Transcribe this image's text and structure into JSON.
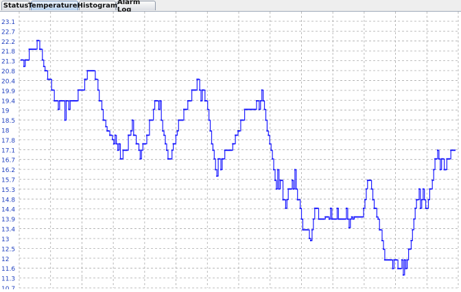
{
  "tabs": [
    {
      "label": "Status",
      "active": false
    },
    {
      "label": "Temperatures",
      "active": true
    },
    {
      "label": "Histogram",
      "active": false
    },
    {
      "label": "Alarm Log",
      "active": false
    }
  ],
  "colors": {
    "series": "#1a1aff",
    "grid": "#a8a8a8",
    "axis_text": "#1f3fbf"
  },
  "chart_data": {
    "type": "line",
    "grid": true,
    "ylim": [
      10.7,
      23.3
    ],
    "yticks": [
      "23.1",
      "22.7",
      "22.2",
      "21.8",
      "21.3",
      "20.8",
      "20.4",
      "19.9",
      "19.4",
      "19",
      "18.5",
      "18",
      "17.8",
      "17.1",
      "16.7",
      "16.2",
      "15.7",
      "15.3",
      "14.8",
      "14.4",
      "13.9",
      "13.4",
      "13",
      "12.5",
      "12",
      "11.6",
      "11.3",
      "10.7"
    ],
    "series": [
      {
        "values": [
          21.3,
          21.3,
          21.0,
          21.3,
          21.3,
          21.3,
          21.8,
          21.8,
          21.8,
          21.8,
          21.8,
          21.8,
          22.2,
          22.2,
          21.8,
          21.8,
          21.3,
          21.0,
          20.8,
          20.8,
          20.4,
          20.4,
          20.4,
          19.9,
          19.9,
          19.4,
          19.4,
          19.4,
          19.0,
          19.4,
          19.4,
          19.4,
          19.4,
          18.5,
          19.4,
          19.4,
          19.0,
          19.4,
          19.4,
          19.4,
          19.4,
          19.4,
          19.4,
          19.9,
          19.9,
          19.9,
          19.9,
          19.9,
          20.4,
          20.4,
          20.8,
          20.8,
          20.8,
          20.8,
          20.8,
          20.8,
          20.4,
          20.4,
          19.9,
          19.4,
          19.4,
          19.0,
          18.5,
          18.5,
          18.2,
          18.0,
          18.0,
          17.8,
          17.8,
          17.6,
          17.4,
          17.8,
          17.4,
          17.1,
          17.4,
          16.7,
          16.7,
          17.1,
          17.1,
          17.1,
          17.1,
          17.8,
          17.8,
          18.0,
          18.5,
          17.8,
          17.8,
          17.4,
          17.4,
          17.1,
          16.7,
          17.1,
          17.4,
          17.4,
          17.4,
          17.8,
          17.8,
          18.5,
          18.5,
          18.5,
          19.0,
          19.4,
          19.4,
          19.4,
          19.0,
          19.4,
          18.5,
          18.0,
          17.8,
          17.4,
          17.1,
          16.7,
          16.7,
          16.7,
          17.1,
          17.4,
          17.4,
          17.8,
          18.0,
          18.5,
          18.5,
          18.5,
          18.5,
          19.0,
          19.0,
          19.0,
          19.4,
          19.4,
          19.4,
          19.9,
          19.9,
          19.9,
          19.9,
          20.4,
          20.4,
          19.9,
          19.4,
          19.9,
          19.9,
          19.4,
          19.4,
          19.0,
          18.5,
          18.0,
          17.4,
          17.1,
          16.7,
          16.2,
          15.9,
          16.7,
          16.7,
          16.2,
          16.7,
          16.7,
          17.1,
          17.1,
          17.1,
          17.1,
          17.1,
          17.1,
          17.4,
          17.4,
          17.8,
          17.8,
          18.0,
          18.0,
          18.5,
          18.5,
          18.5,
          19.0,
          19.0,
          19.0,
          19.0,
          19.0,
          19.0,
          19.0,
          19.0,
          19.0,
          19.4,
          19.4,
          19.0,
          19.4,
          19.9,
          19.4,
          19.0,
          18.5,
          18.0,
          17.8,
          17.4,
          17.1,
          16.7,
          16.2,
          15.7,
          15.3,
          16.2,
          15.3,
          15.7,
          15.7,
          14.8,
          14.8,
          14.4,
          14.8,
          15.3,
          15.3,
          15.3,
          15.7,
          15.3,
          16.2,
          15.3,
          14.8,
          14.8,
          14.4,
          13.9,
          13.4,
          13.4,
          13.4,
          13.4,
          13.4,
          13.0,
          12.9,
          13.4,
          13.9,
          14.4,
          14.4,
          14.4,
          13.9,
          13.9,
          13.9,
          13.9,
          13.9,
          14.0,
          14.0,
          14.0,
          13.9,
          14.4,
          13.9,
          13.9,
          13.9,
          13.9,
          14.4,
          13.9,
          13.9,
          13.9,
          13.9,
          13.9,
          13.9,
          14.4,
          13.9,
          13.5,
          13.9,
          14.0,
          13.9,
          14.0,
          14.0,
          14.0,
          14.0,
          14.0,
          14.0,
          14.0,
          14.4,
          14.8,
          15.3,
          15.7,
          15.7,
          15.7,
          15.3,
          14.8,
          14.4,
          14.4,
          14.0,
          13.9,
          13.4,
          13.4,
          12.9,
          12.5,
          12.0,
          12.0,
          12.0,
          12.0,
          12.0,
          12.0,
          11.6,
          12.0,
          12.0,
          12.0,
          11.6,
          11.6,
          11.6,
          12.0,
          11.3,
          12.0,
          11.6,
          12.0,
          12.5,
          12.5,
          12.9,
          13.4,
          13.9,
          14.4,
          14.8,
          14.8,
          15.3,
          14.4,
          14.8,
          15.3,
          14.8,
          14.4,
          14.4,
          14.8,
          15.3,
          15.3,
          15.7,
          16.2,
          16.7,
          16.7,
          17.1,
          16.7,
          16.2,
          16.7,
          16.7,
          16.2,
          16.2,
          16.7,
          16.7,
          16.7,
          17.1,
          17.1,
          17.1,
          17.1
        ]
      }
    ]
  }
}
